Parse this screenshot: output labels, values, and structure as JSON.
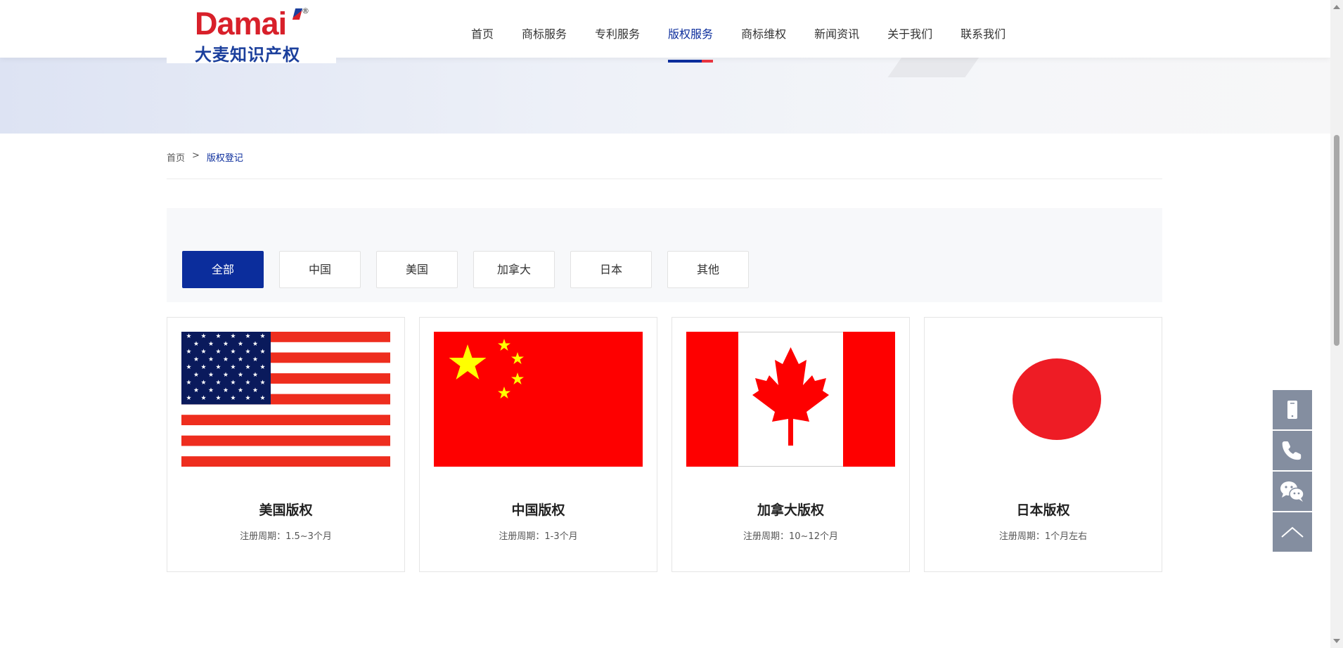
{
  "header": {
    "logo_latin": "Damai",
    "logo_cn": "大麦知识产权",
    "logo_reg": "®",
    "nav": [
      {
        "label": "首页",
        "active": false
      },
      {
        "label": "商标服务",
        "active": false
      },
      {
        "label": "专利服务",
        "active": false
      },
      {
        "label": "版权服务",
        "active": true
      },
      {
        "label": "商标维权",
        "active": false
      },
      {
        "label": "新闻资讯",
        "active": false
      },
      {
        "label": "关于我们",
        "active": false
      },
      {
        "label": "联系我们",
        "active": false
      }
    ]
  },
  "breadcrumb": {
    "home": "首页",
    "separator": ">",
    "current": "版权登记"
  },
  "filter": {
    "tabs": [
      "全部",
      "中国",
      "美国",
      "加拿大",
      "日本",
      "其他"
    ],
    "active_index": 0
  },
  "cards": [
    {
      "title": "美国版权",
      "subtitle": "注册周期：1.5~3个月",
      "flag": "us-flag"
    },
    {
      "title": "中国版权",
      "subtitle": "注册周期：1-3个月",
      "flag": "china-flag"
    },
    {
      "title": "加拿大版权",
      "subtitle": "注册周期：10~12个月",
      "flag": "canada-flag"
    },
    {
      "title": "日本版权",
      "subtitle": "注册周期：1个月左右",
      "flag": "japan-flag"
    }
  ],
  "side_tools": [
    "mobile-icon",
    "phone-icon",
    "wechat-icon",
    "back-to-top-icon"
  ],
  "colors": {
    "primary": "#0b2d9c",
    "accent": "#e8343f",
    "brand_red": "#d8202a",
    "side_tool_bg": "#848ea0"
  }
}
